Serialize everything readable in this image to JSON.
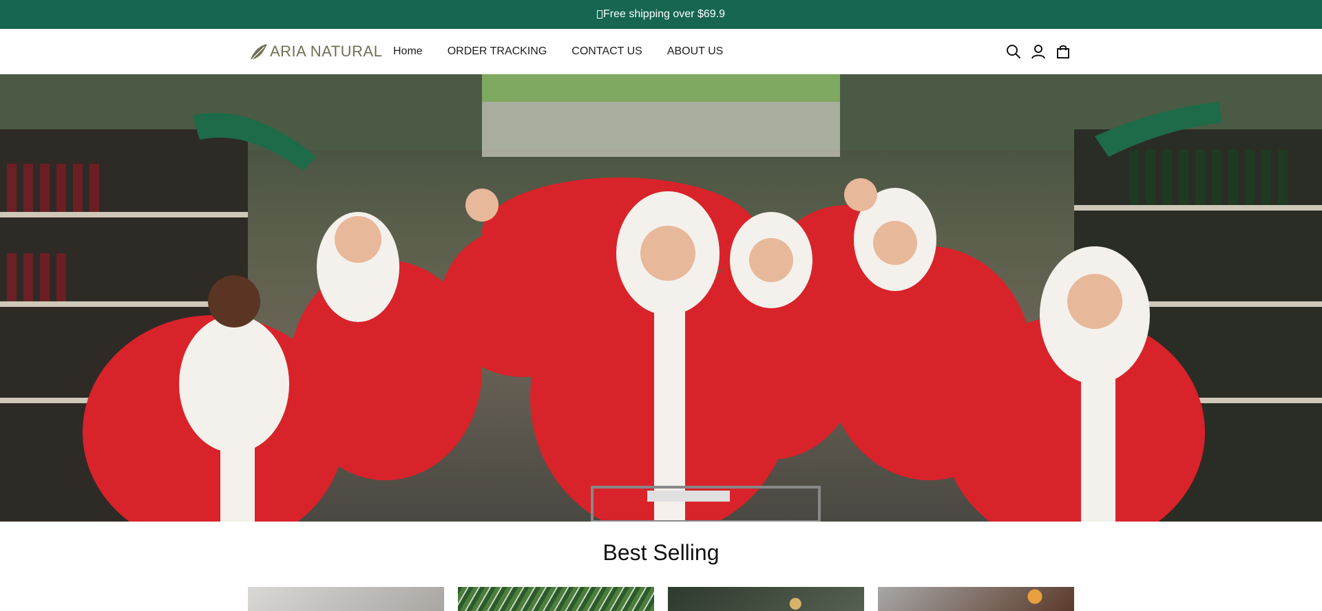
{
  "announcement": {
    "text": "Free shipping over $69.9"
  },
  "header": {
    "logo_text": "ARIA NATURAL",
    "nav": [
      {
        "label": "Home"
      },
      {
        "label": "ORDER TRACKING"
      },
      {
        "label": "CONTACT US"
      },
      {
        "label": "ABOUT US"
      }
    ],
    "icons": [
      "search-icon",
      "account-icon",
      "cart-icon"
    ]
  },
  "hero": {
    "image": "Christmas shoppers in Santa costumes in a wine aisle"
  },
  "best_selling": {
    "title": "Best Selling",
    "products": [
      {
        "image": "product-1"
      },
      {
        "image": "product-2"
      },
      {
        "image": "product-3"
      },
      {
        "image": "product-4"
      }
    ]
  },
  "colors": {
    "accent": "#166651",
    "logo": "#6f6f54"
  }
}
